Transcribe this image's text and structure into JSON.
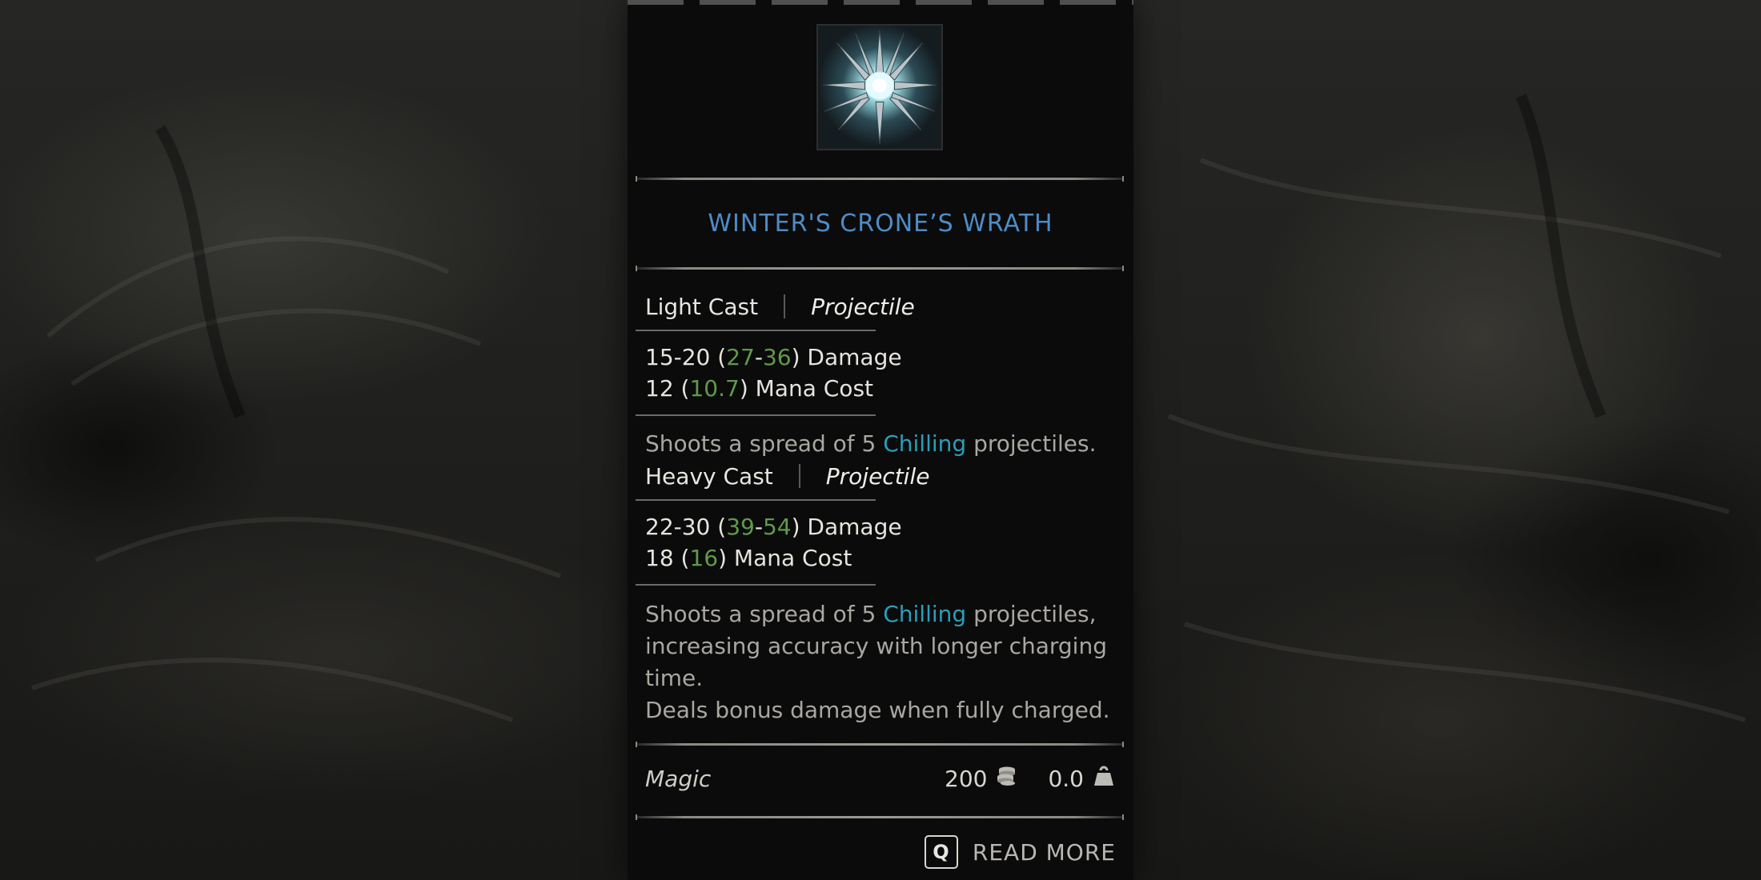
{
  "spell": {
    "title": "WINTER'S CRONE’S WRATH",
    "icon": "ice-shard-burst-icon"
  },
  "light_cast": {
    "label": "Light Cast",
    "type": "Projectile",
    "damage_base": "15-20",
    "damage_open": " (",
    "damage_mod_low": "27",
    "damage_dash": "-",
    "damage_mod_high": "36",
    "damage_close": ") Damage",
    "mana_base": "12",
    "mana_open": " (",
    "mana_mod": "10.7",
    "mana_close": ") Mana Cost",
    "desc_pre": "Shoots a spread of 5 ",
    "desc_keyword": "Chilling",
    "desc_post": " projectiles."
  },
  "heavy_cast": {
    "label": "Heavy Cast",
    "type": "Projectile",
    "damage_base": "22-30",
    "damage_open": " (",
    "damage_mod_low": "39",
    "damage_dash": "-",
    "damage_mod_high": "54",
    "damage_close": ") Damage",
    "mana_base": "18",
    "mana_open": " (",
    "mana_mod": "16",
    "mana_close": ") Mana Cost",
    "desc_pre": "Shoots a spread of 5 ",
    "desc_keyword": "Chilling",
    "desc_post": " projectiles, increasing accuracy with longer charging time.",
    "desc_line2": "Deals bonus damage when fully charged."
  },
  "footer": {
    "rarity": "Magic",
    "price": "200",
    "price_icon": "coin-stack-icon",
    "weight": "0.0",
    "weight_icon": "weight-icon"
  },
  "read_more": {
    "key": "Q",
    "label": "READ MORE"
  },
  "colors": {
    "title": "#4d8cc6",
    "bonus_value": "#5f9a4c",
    "keyword": "#2a9eb8",
    "panel_bg": "#0b0b0b"
  }
}
